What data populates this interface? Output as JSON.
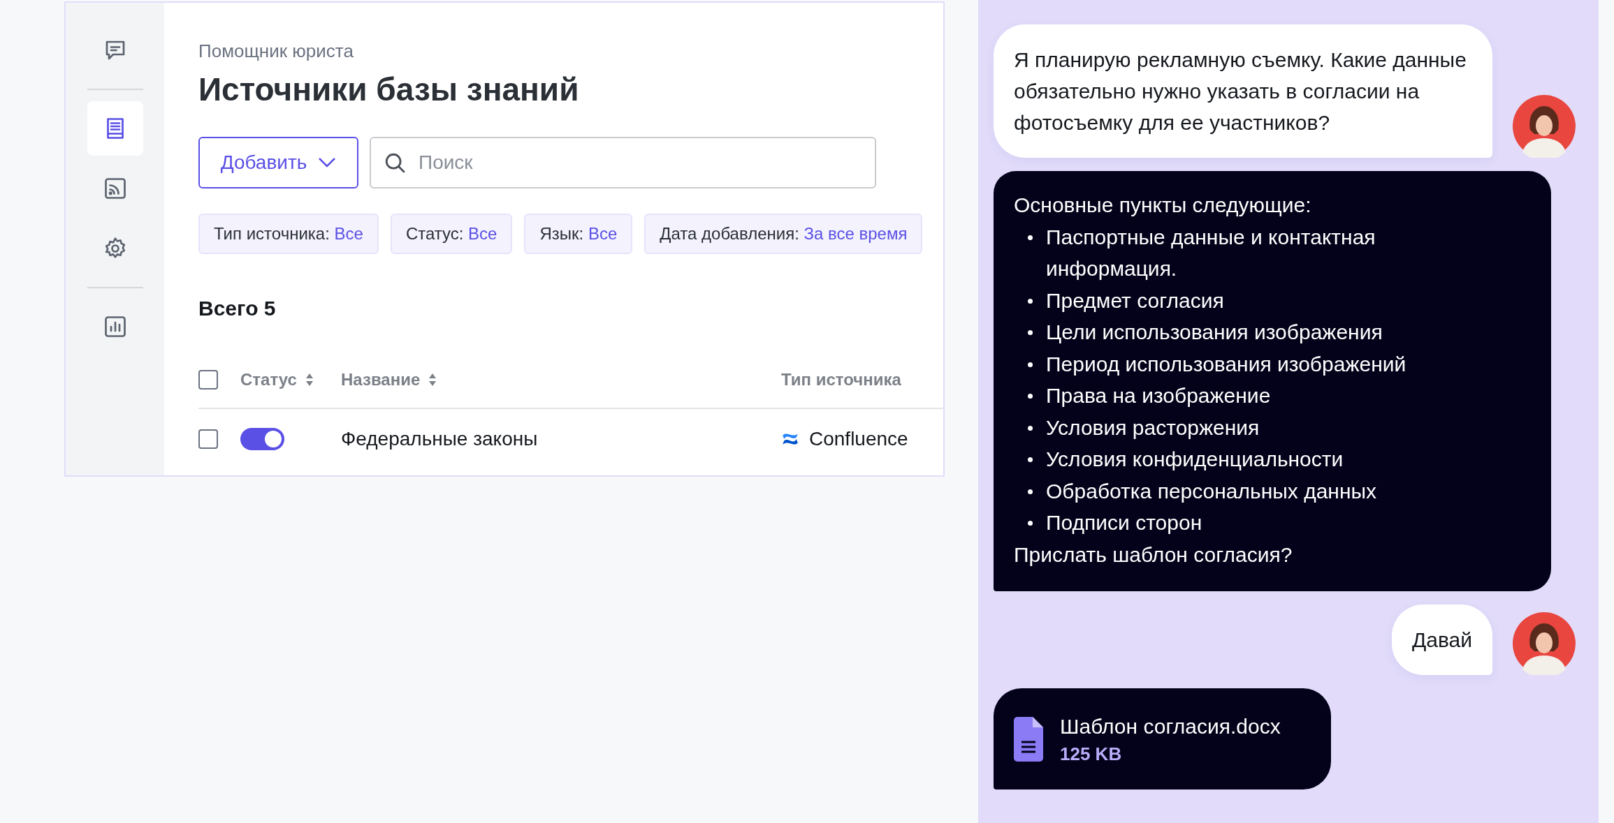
{
  "sidebar": {
    "items": [
      {
        "selected": false
      },
      {
        "selected": true
      },
      {
        "selected": false
      },
      {
        "selected": false
      },
      {
        "selected": false
      }
    ]
  },
  "header": {
    "subtitle": "Помощник юриста",
    "title": "Источники базы знаний"
  },
  "toolbar": {
    "add_button": "Добавить",
    "search": {
      "placeholder": "Поиск"
    }
  },
  "filters": [
    {
      "label": "Тип источника:",
      "value": "Все"
    },
    {
      "label": "Статус:",
      "value": "Все"
    },
    {
      "label": "Язык:",
      "value": "Все"
    },
    {
      "label": "Дата добавления:",
      "value": "За все время"
    }
  ],
  "total": "Всего 5",
  "table": {
    "select_all_checked": false,
    "columns": [
      {
        "kind": "sortable",
        "label": "Статус"
      },
      {
        "kind": "sortable",
        "label": "Название"
      },
      {
        "kind": "plain",
        "label": "Тип источника"
      }
    ],
    "rows": [
      {
        "checked": false,
        "on": true,
        "name": "Федеральные законы",
        "source": "Confluence"
      }
    ]
  },
  "chat": {
    "messages": [
      {
        "kind": "user",
        "text": "Я планирую рекламную съемку. Какие данные обязательно нужно указать в согласии на фотосъемку для ее участников?"
      },
      {
        "kind": "bot",
        "intro": "Основные пункты следующие:",
        "bullets": [
          "Паспортные данные и контактная информация.",
          "Предмет согласия",
          "Цели использования изображения",
          "Период использования изображений",
          "Права на изображение",
          "Условия расторжения",
          "Условия конфиденциальности",
          "Обработка персональных данных",
          "Подписи сторон"
        ],
        "outro": "Прислать шаблон согласия?"
      },
      {
        "kind": "user",
        "text": "Давай"
      },
      {
        "kind": "file",
        "name": "Шаблон согласия.docx",
        "size": "125 KB"
      }
    ]
  }
}
